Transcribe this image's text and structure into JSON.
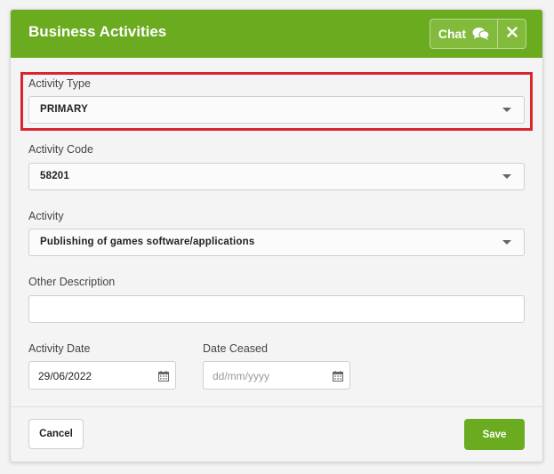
{
  "modal": {
    "title": "Business Activities",
    "chat_label": "Chat",
    "accent_color": "#6aab20",
    "highlight_color": "#d8262c"
  },
  "form": {
    "activity_type": {
      "label": "Activity Type",
      "value": "PRIMARY"
    },
    "activity_code": {
      "label": "Activity Code",
      "value": "58201"
    },
    "activity": {
      "label": "Activity",
      "value": "Publishing of games software/applications"
    },
    "other_description": {
      "label": "Other Description",
      "value": ""
    },
    "activity_date": {
      "label": "Activity Date",
      "value": "29/06/2022"
    },
    "date_ceased": {
      "label": "Date Ceased",
      "placeholder": "dd/mm/yyyy",
      "value": ""
    }
  },
  "footer": {
    "cancel_label": "Cancel",
    "save_label": "Save"
  },
  "icons": {
    "chat": "chat-bubbles-icon",
    "close": "close-icon",
    "calendar": "calendar-icon",
    "dropdown": "chevron-down-icon"
  }
}
